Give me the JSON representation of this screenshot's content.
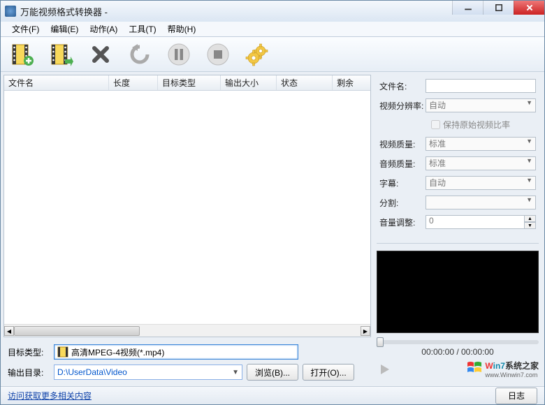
{
  "title": "万能视频格式转换器 - ",
  "menu": {
    "file": "文件(F)",
    "edit": "编辑(E)",
    "action": "动作(A)",
    "tool": "工具(T)",
    "help": "帮助(H)"
  },
  "toolbar": {
    "add_file": "add-file",
    "add_folder": "add-folder",
    "delete": "delete",
    "refresh": "refresh",
    "pause": "pause",
    "stop": "stop",
    "settings": "settings"
  },
  "table_headers": {
    "filename": "文件名",
    "length": "长度",
    "target_type": "目标类型",
    "output_size": "输出大小",
    "status": "状态",
    "remaining": "剩余"
  },
  "bottom": {
    "target_type_label": "目标类型:",
    "target_type_value": "高清MPEG-4视频(*.mp4)",
    "output_dir_label": "输出目录:",
    "output_dir_value": "D:\\UserData\\Video",
    "browse": "浏览(B)...",
    "open": "打开(O)...",
    "log": "日志"
  },
  "side": {
    "filename_lbl": "文件名:",
    "filename_val": "",
    "res_lbl": "视频分辨率:",
    "res_val": "自动",
    "keep_ratio": "保持原始视频比率",
    "vq_lbl": "视频质量:",
    "vq_val": "标准",
    "aq_lbl": "音频质量:",
    "aq_val": "标准",
    "sub_lbl": "字幕:",
    "sub_val": "自动",
    "split_lbl": "分割:",
    "split_val": "",
    "vol_lbl": "音量调整:",
    "vol_val": "0"
  },
  "time_display": "00:00:00 / 00:00:00",
  "status_link": "访问获取更多相关内容",
  "watermark_line1": "Win7系统之家",
  "watermark_line2": "www.Winwin7.com"
}
